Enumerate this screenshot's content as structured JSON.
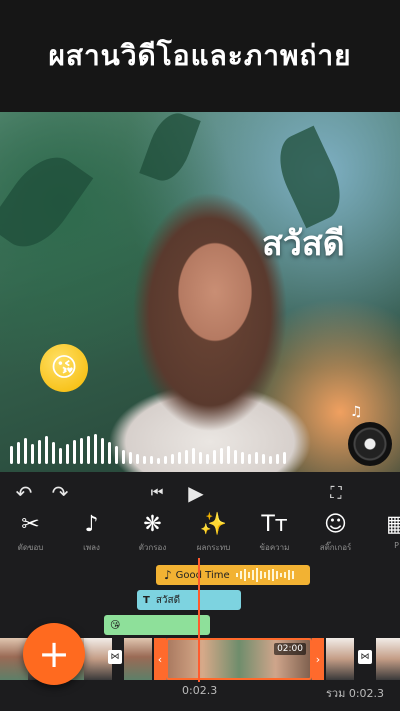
{
  "header": {
    "title": "ผสานวิดีโอและภาพถ่าย"
  },
  "preview": {
    "text_sticker": "สวัสดี",
    "emoji_sticker": "😘",
    "note": "♫"
  },
  "controls": {
    "undo": "↶",
    "redo": "↷",
    "prev": "⏮",
    "play": "▶",
    "fullscreen": "⛶"
  },
  "toolbar": {
    "items": [
      {
        "icon": "✂",
        "label": "ตัดขอบ"
      },
      {
        "icon": "♪",
        "label": "เพลง"
      },
      {
        "icon": "❋",
        "label": "ตัวกรอง"
      },
      {
        "icon": "✨",
        "label": "ผลกระทบ"
      },
      {
        "icon": "Tт",
        "label": "ข้อความ"
      },
      {
        "icon": "☺",
        "label": "สติ๊กเกอร์"
      },
      {
        "icon": "▦",
        "label": "P"
      }
    ]
  },
  "timeline": {
    "music_label": "Good Time",
    "music_icon": "♪",
    "text_label": "สวัสดี",
    "text_icon": "T",
    "sticker_icon": "😘",
    "clip_duration": "02:00",
    "current_time": "0:02.3",
    "total_label": "รวม",
    "total_time": "0:02.3",
    "transition_icon": "⋈",
    "handle_left": "‹",
    "handle_right": "›"
  },
  "fab": {
    "label": "+"
  },
  "colors": {
    "accent": "#ff6a1f",
    "music": "#f2b233",
    "text": "#7dd3e0",
    "sticker": "#8ee09a"
  }
}
